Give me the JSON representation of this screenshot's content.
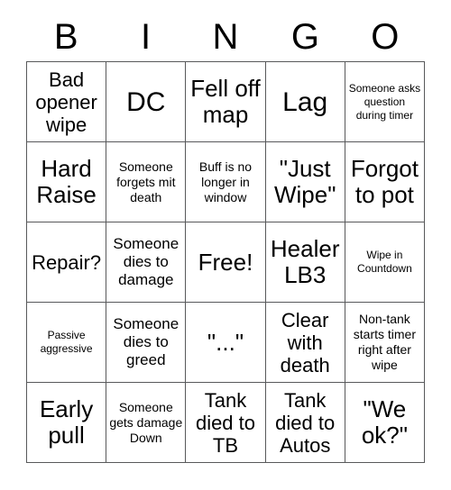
{
  "card": {
    "header_letters": [
      "B",
      "I",
      "N",
      "G",
      "O"
    ],
    "rows": [
      [
        {
          "text": "Bad opener wipe",
          "size": "fs-l"
        },
        {
          "text": "DC",
          "size": "fs-xxl"
        },
        {
          "text": "Fell off map",
          "size": "fs-xl"
        },
        {
          "text": "Lag",
          "size": "fs-xxl"
        },
        {
          "text": "Someone asks question during timer",
          "size": "fs-xs"
        }
      ],
      [
        {
          "text": "Hard Raise",
          "size": "fs-xl"
        },
        {
          "text": "Someone forgets mit death",
          "size": "fs-s"
        },
        {
          "text": "Buff is no longer in window",
          "size": "fs-s"
        },
        {
          "text": "\"Just Wipe\"",
          "size": "fs-xl"
        },
        {
          "text": "Forgot to pot",
          "size": "fs-xl"
        }
      ],
      [
        {
          "text": "Repair?",
          "size": "fs-l"
        },
        {
          "text": "Someone dies to damage",
          "size": "fs-m"
        },
        {
          "text": "Free!",
          "size": "fs-xl"
        },
        {
          "text": "Healer LB3",
          "size": "fs-xl"
        },
        {
          "text": "Wipe in Countdown",
          "size": "fs-xs"
        }
      ],
      [
        {
          "text": "Passive aggressive",
          "size": "fs-xs"
        },
        {
          "text": "Someone dies to greed",
          "size": "fs-m"
        },
        {
          "text": "\"...\"",
          "size": "fs-xl"
        },
        {
          "text": "Clear with death",
          "size": "fs-l"
        },
        {
          "text": "Non-tank starts timer right after wipe",
          "size": "fs-s"
        }
      ],
      [
        {
          "text": "Early pull",
          "size": "fs-xl"
        },
        {
          "text": "Someone gets damage Down",
          "size": "fs-s"
        },
        {
          "text": "Tank died to TB",
          "size": "fs-l"
        },
        {
          "text": "Tank died to Autos",
          "size": "fs-l"
        },
        {
          "text": "\"We ok?\"",
          "size": "fs-xl"
        }
      ]
    ]
  }
}
